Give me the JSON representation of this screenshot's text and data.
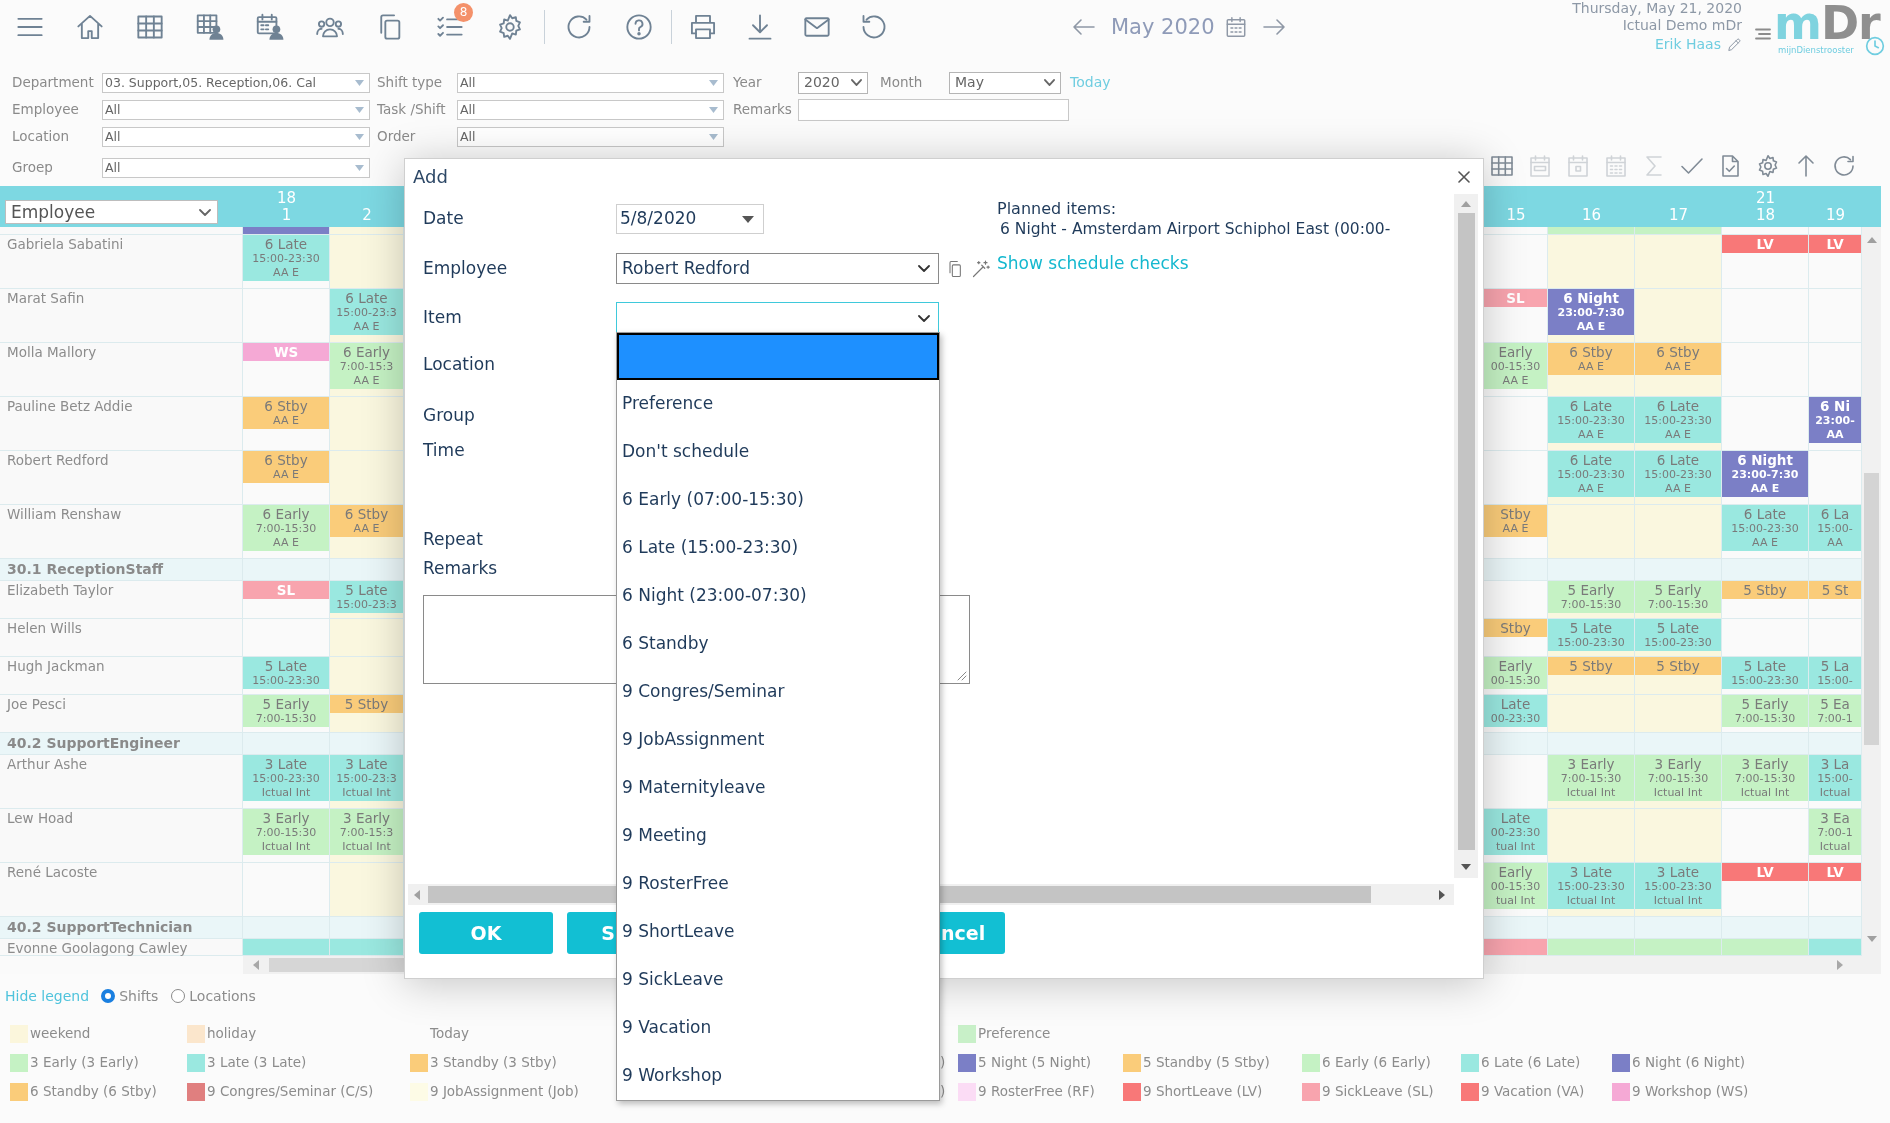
{
  "toolbar": {
    "badge": "8"
  },
  "month_nav": {
    "label": "May 2020"
  },
  "session": {
    "date": "Thursday, May 21, 2020",
    "organization": "Ictual Demo mDr",
    "user": "Erik Haas"
  },
  "logo": {
    "parts": [
      "m",
      "Dr"
    ],
    "tagline": "mijnDienstrooster"
  },
  "filters": {
    "column_1": [
      {
        "label": "Department",
        "value": "03. Support,05. Reception,06. Cal"
      },
      {
        "label": "Employee",
        "value": "All"
      },
      {
        "label": "Location",
        "value": "All"
      },
      {
        "label": "Groep",
        "value": "All"
      }
    ],
    "column_2": [
      {
        "label": "Shift type",
        "value": "All"
      },
      {
        "label": "Task /Shift",
        "value": "All"
      },
      {
        "label": "Order",
        "value": "All"
      }
    ],
    "year": {
      "label": "Year",
      "value": "2020"
    },
    "month": {
      "label": "Month",
      "value": "May"
    },
    "today_link": "Today",
    "remarks": {
      "label": "Remarks"
    }
  },
  "grid_toolbar": [
    {
      "disabled": false
    },
    {
      "disabled": true
    },
    {
      "disabled": true
    },
    {
      "disabled": true
    },
    {
      "disabled": true
    },
    {
      "disabled": false
    },
    {
      "disabled": false
    },
    {
      "disabled": false
    },
    {
      "disabled": false
    },
    {
      "disabled": false
    }
  ],
  "grid": {
    "employee_select": "Employee",
    "columns": [
      {
        "day": "1",
        "week": "18",
        "weekend": false
      },
      {
        "day": "2",
        "weekend": true
      },
      {
        "day": "15",
        "weekend": false
      },
      {
        "day": "16",
        "weekend": true
      },
      {
        "day": "17",
        "weekend": true
      },
      {
        "day": "18",
        "week": "21",
        "weekend": false
      },
      {
        "day": "19",
        "weekend": false
      }
    ],
    "rows": [
      {
        "kind": "partial",
        "cells": [
          {
            "color": "#7b7fc6"
          },
          null,
          null,
          {
            "color": "#c5f2c4"
          },
          {
            "color": "#c5f2c4"
          },
          null,
          null
        ]
      },
      {
        "kind": "employee",
        "name": "Gabriela Sabatini",
        "cells": [
          {
            "color": "#9ae8e0",
            "dark": false,
            "lines": [
              "6 Late",
              "15:00-23:30",
              "AA E"
            ]
          },
          null,
          null,
          null,
          null,
          {
            "color": "#f87878",
            "dark": true,
            "lines": [
              "LV"
            ]
          },
          {
            "color": "#f87878",
            "dark": true,
            "lines": [
              "LV"
            ]
          }
        ]
      },
      {
        "kind": "employee",
        "name": "Marat Safin",
        "cells": [
          null,
          {
            "color": "#9ae8e0",
            "dark": false,
            "lines": [
              "6 Late",
              "15:00-23:3",
              "AA E"
            ]
          },
          {
            "color": "#f8a4ae",
            "dark": true,
            "lines": [
              "SL"
            ]
          },
          {
            "color": "#7b7fc6",
            "dark": true,
            "lines": [
              "6 Night",
              "23:00-7:30",
              "AA E"
            ]
          },
          null,
          null,
          null
        ]
      },
      {
        "kind": "employee",
        "name": "Molla Mallory",
        "cells": [
          {
            "color": "#f5a9d5",
            "dark": true,
            "lines": [
              "WS"
            ]
          },
          {
            "color": "#c5f2c4",
            "dark": false,
            "lines": [
              "6 Early",
              "7:00-15:3",
              "AA E"
            ]
          },
          {
            "color": "#c5f2c4",
            "dark": false,
            "lines": [
              "Early",
              "00-15:30",
              "AA E"
            ]
          },
          {
            "color": "#facc7a",
            "dark": false,
            "lines": [
              "6 Stby",
              "AA E"
            ]
          },
          {
            "color": "#facc7a",
            "dark": false,
            "lines": [
              "6 Stby",
              "AA E"
            ]
          },
          null,
          null
        ]
      },
      {
        "kind": "employee",
        "name": "Pauline Betz Addie",
        "cells": [
          {
            "color": "#facc7a",
            "dark": false,
            "lines": [
              "6 Stby",
              "AA E"
            ]
          },
          null,
          null,
          {
            "color": "#9ae8e0",
            "dark": false,
            "lines": [
              "6 Late",
              "15:00-23:30",
              "AA E"
            ]
          },
          {
            "color": "#9ae8e0",
            "dark": false,
            "lines": [
              "6 Late",
              "15:00-23:30",
              "AA E"
            ]
          },
          null,
          {
            "color": "#7b7fc6",
            "dark": true,
            "lines": [
              "6 Ni",
              "23:00-",
              "AA"
            ]
          }
        ]
      },
      {
        "kind": "employee",
        "name": "Robert Redford",
        "cells": [
          {
            "color": "#facc7a",
            "dark": false,
            "lines": [
              "6 Stby",
              "AA E"
            ]
          },
          null,
          null,
          {
            "color": "#9ae8e0",
            "dark": false,
            "lines": [
              "6 Late",
              "15:00-23:30",
              "AA E"
            ]
          },
          {
            "color": "#9ae8e0",
            "dark": false,
            "lines": [
              "6 Late",
              "15:00-23:30",
              "AA E"
            ]
          },
          {
            "color": "#7b7fc6",
            "dark": true,
            "lines": [
              "6 Night",
              "23:00-7:30",
              "AA E"
            ]
          },
          null
        ]
      },
      {
        "kind": "employee",
        "name": "William Renshaw",
        "cells": [
          {
            "color": "#c5f2c4",
            "dark": false,
            "lines": [
              "6 Early",
              "7:00-15:30",
              "AA E"
            ]
          },
          {
            "color": "#facc7a",
            "dark": false,
            "lines": [
              "6 Stby",
              "AA E"
            ]
          },
          {
            "color": "#facc7a",
            "dark": false,
            "lines": [
              "Stby",
              "AA E"
            ]
          },
          null,
          null,
          {
            "color": "#9ae8e0",
            "dark": false,
            "lines": [
              "6 Late",
              "15:00-23:30",
              "AA E"
            ]
          },
          {
            "color": "#9ae8e0",
            "dark": false,
            "lines": [
              "6 La",
              "15:00-",
              "AA"
            ]
          }
        ]
      },
      {
        "kind": "group",
        "name": "30.1 ReceptionStaff"
      },
      {
        "kind": "employee",
        "name": "Elizabeth Taylor",
        "cells": [
          {
            "color": "#f8a4ae",
            "dark": true,
            "lines": [
              "SL"
            ]
          },
          {
            "color": "#9ae8e0",
            "dark": false,
            "lines": [
              "5 Late",
              "15:00-23:3"
            ]
          },
          null,
          {
            "color": "#c5f2c4",
            "dark": false,
            "lines": [
              "5 Early",
              "7:00-15:30"
            ]
          },
          {
            "color": "#c5f2c4",
            "dark": false,
            "lines": [
              "5 Early",
              "7:00-15:30"
            ]
          },
          {
            "color": "#facc7a",
            "dark": false,
            "lines": [
              "5 Stby"
            ]
          },
          {
            "color": "#facc7a",
            "dark": false,
            "lines": [
              "5 St"
            ]
          }
        ]
      },
      {
        "kind": "employee",
        "name": "Helen Wills",
        "cells": [
          null,
          null,
          {
            "color": "#facc7a",
            "dark": false,
            "lines": [
              "Stby"
            ]
          },
          {
            "color": "#9ae8e0",
            "dark": false,
            "lines": [
              "5 Late",
              "15:00-23:30"
            ]
          },
          {
            "color": "#9ae8e0",
            "dark": false,
            "lines": [
              "5 Late",
              "15:00-23:30"
            ]
          },
          null,
          null
        ]
      },
      {
        "kind": "employee",
        "name": "Hugh Jackman",
        "cells": [
          {
            "color": "#9ae8e0",
            "dark": false,
            "lines": [
              "5 Late",
              "15:00-23:30"
            ]
          },
          null,
          {
            "color": "#c5f2c4",
            "dark": false,
            "lines": [
              "Early",
              "00-15:30"
            ]
          },
          {
            "color": "#facc7a",
            "dark": false,
            "lines": [
              "5 Stby"
            ]
          },
          {
            "color": "#facc7a",
            "dark": false,
            "lines": [
              "5 Stby"
            ]
          },
          {
            "color": "#9ae8e0",
            "dark": false,
            "lines": [
              "5 Late",
              "15:00-23:30"
            ]
          },
          {
            "color": "#9ae8e0",
            "dark": false,
            "lines": [
              "5 La",
              "15:00-"
            ]
          }
        ]
      },
      {
        "kind": "employee",
        "name": "Joe Pesci",
        "cells": [
          {
            "color": "#c5f2c4",
            "dark": false,
            "lines": [
              "5 Early",
              "7:00-15:30"
            ]
          },
          {
            "color": "#facc7a",
            "dark": false,
            "lines": [
              "5 Stby"
            ]
          },
          {
            "color": "#9ae8e0",
            "dark": false,
            "lines": [
              "Late",
              "00-23:30"
            ]
          },
          null,
          null,
          {
            "color": "#c5f2c4",
            "dark": false,
            "lines": [
              "5 Early",
              "7:00-15:30"
            ]
          },
          {
            "color": "#c5f2c4",
            "dark": false,
            "lines": [
              "5 Ea",
              "7:00-1"
            ]
          }
        ]
      },
      {
        "kind": "group",
        "name": "40.2 SupportEngineer"
      },
      {
        "kind": "employee",
        "name": "Arthur Ashe",
        "cells": [
          {
            "color": "#9ae8e0",
            "dark": false,
            "lines": [
              "3 Late",
              "15:00-23:30",
              "Ictual Int"
            ]
          },
          {
            "color": "#9ae8e0",
            "dark": false,
            "lines": [
              "3 Late",
              "15:00-23:3",
              "Ictual Int"
            ]
          },
          null,
          {
            "color": "#c5f2c4",
            "dark": false,
            "lines": [
              "3 Early",
              "7:00-15:30",
              "Ictual Int"
            ]
          },
          {
            "color": "#c5f2c4",
            "dark": false,
            "lines": [
              "3 Early",
              "7:00-15:30",
              "Ictual Int"
            ]
          },
          {
            "color": "#c5f2c4",
            "dark": false,
            "lines": [
              "3 Early",
              "7:00-15:30",
              "Ictual Int"
            ]
          },
          {
            "color": "#9ae8e0",
            "dark": false,
            "lines": [
              "3 La",
              "15:00-",
              "Ictual"
            ]
          }
        ]
      },
      {
        "kind": "employee",
        "name": "Lew Hoad",
        "cells": [
          {
            "color": "#c5f2c4",
            "dark": false,
            "lines": [
              "3 Early",
              "7:00-15:30",
              "Ictual Int"
            ]
          },
          {
            "color": "#c5f2c4",
            "dark": false,
            "lines": [
              "3 Early",
              "7:00-15:3",
              "Ictual Int"
            ]
          },
          {
            "color": "#9ae8e0",
            "dark": false,
            "lines": [
              "Late",
              "00-23:30",
              "tual Int"
            ]
          },
          null,
          null,
          null,
          {
            "color": "#c5f2c4",
            "dark": false,
            "lines": [
              "3 Ea",
              "7:00-1",
              "Ictual"
            ]
          }
        ]
      },
      {
        "kind": "employee",
        "name": "René Lacoste",
        "cells": [
          null,
          null,
          {
            "color": "#c5f2c4",
            "dark": false,
            "lines": [
              "Early",
              "00-15:30",
              "tual Int"
            ]
          },
          {
            "color": "#9ae8e0",
            "dark": false,
            "lines": [
              "3 Late",
              "15:00-23:30",
              "Ictual Int"
            ]
          },
          {
            "color": "#9ae8e0",
            "dark": false,
            "lines": [
              "3 Late",
              "15:00-23:30",
              "Ictual Int"
            ]
          },
          {
            "color": "#f87878",
            "dark": true,
            "lines": [
              "LV"
            ]
          },
          {
            "color": "#f87878",
            "dark": true,
            "lines": [
              "LV"
            ]
          }
        ]
      },
      {
        "kind": "group",
        "name": "40.2 SupportTechnician"
      },
      {
        "kind": "employee",
        "name": "Evonne Goolagong Cawley",
        "cells": [
          {
            "color": "#9ae8e0"
          },
          {
            "color": "#9ae8e0"
          },
          {
            "color": "#f8a4ae"
          },
          {
            "color": "#c5f2c4"
          },
          {
            "color": "#c5f2c4"
          },
          {
            "color": "#c5f2c4"
          },
          {
            "color": "#9ae8e0"
          }
        ]
      }
    ]
  },
  "dialog": {
    "title": "Add",
    "planned": {
      "heading": "Planned items:",
      "items": [
        "6 Night - Amsterdam Airport Schiphol East (00:00-"
      ]
    },
    "schedule_checks_link": "Show schedule checks",
    "fields": [
      {
        "kind": "date",
        "label": "Date",
        "value": "5/8/2020"
      },
      {
        "kind": "select",
        "label": "Employee",
        "value": "Robert Redford",
        "expanded": false
      },
      {
        "kind": "select",
        "label": "Item",
        "expanded": true,
        "options": [
          {
            "selected": true
          },
          {
            "label": "Preference",
            "selected": false
          },
          {
            "label": "Don't schedule",
            "selected": false
          },
          {
            "label": "6 Early (07:00-15:30)",
            "selected": false
          },
          {
            "label": "6 Late (15:00-23:30)",
            "selected": false
          },
          {
            "label": "6 Night (23:00-07:30)",
            "selected": false
          },
          {
            "label": "6 Standby",
            "selected": false
          },
          {
            "label": "9 Congres/Seminar",
            "selected": false
          },
          {
            "label": "9 JobAssignment",
            "selected": false
          },
          {
            "label": "9 Maternityleave",
            "selected": false
          },
          {
            "label": "9 Meeting",
            "selected": false
          },
          {
            "label": "9 RosterFree",
            "selected": false
          },
          {
            "label": "9 ShortLeave",
            "selected": false
          },
          {
            "label": "9 SickLeave",
            "selected": false
          },
          {
            "label": "9 Vacation",
            "selected": false
          },
          {
            "label": "9 Workshop",
            "selected": false
          }
        ]
      },
      {
        "kind": "label",
        "label": "Location"
      },
      {
        "kind": "label",
        "label": "Group"
      },
      {
        "kind": "label",
        "label": "Time"
      },
      {
        "kind": "label",
        "label": "Repeat"
      },
      {
        "kind": "textarea",
        "label": "Remarks"
      }
    ],
    "buttons": [
      "OK",
      "S",
      "ncel"
    ]
  },
  "legend": {
    "toggle": "Hide legend",
    "modes": [
      {
        "label": "Shifts",
        "selected": true
      },
      {
        "label": "Locations",
        "selected": false
      }
    ],
    "rows": [
      [
        {
          "label": "weekend",
          "color": "#fbf6dc"
        },
        {
          "label": "holiday",
          "color": "#fbe6cc"
        },
        {
          "label": "Today"
        },
        null,
        {
          "label": "Preference",
          "color": "#c8f0c8"
        }
      ],
      [
        {
          "label": "3 Early (3 Early)",
          "color": "#c5f2c4"
        },
        {
          "label": "3 Late (3 Late)",
          "color": "#9ae8e0"
        },
        {
          "label": "3 Standby (3 Stby)",
          "color": "#facc7a"
        },
        {
          "label": ")"
        },
        {
          "label": "5 Night (5 Night)",
          "color": "#7b7fc6"
        },
        {
          "label": "5 Standby (5 Stby)",
          "color": "#facc7a"
        },
        {
          "label": "6 Early (6 Early)",
          "color": "#c5f2c4"
        },
        {
          "label": "6 Late (6 Late)",
          "color": "#9ae8e0"
        },
        {
          "label": "6 Night (6 Night)",
          "color": "#7b7fc6"
        }
      ],
      [
        {
          "label": "6 Standby (6 Stby)",
          "color": "#facc7a"
        },
        {
          "label": "9 Congres/Seminar (C/S)",
          "color": "#e07f7f"
        },
        {
          "label": "9 JobAssignment (Job)",
          "color": "#fdfbe6"
        },
        {
          "label": ")"
        },
        {
          "label": "9 RosterFree (RF)",
          "color": "#fbdcf5"
        },
        {
          "label": "9 ShortLeave (LV)",
          "color": "#f87878"
        },
        {
          "label": "9 SickLeave (SL)",
          "color": "#f8a4ae"
        },
        {
          "label": "9 Vacation (VA)",
          "color": "#f87878"
        },
        {
          "label": "9 Workshop (WS)",
          "color": "#f5a9d5"
        }
      ]
    ]
  }
}
